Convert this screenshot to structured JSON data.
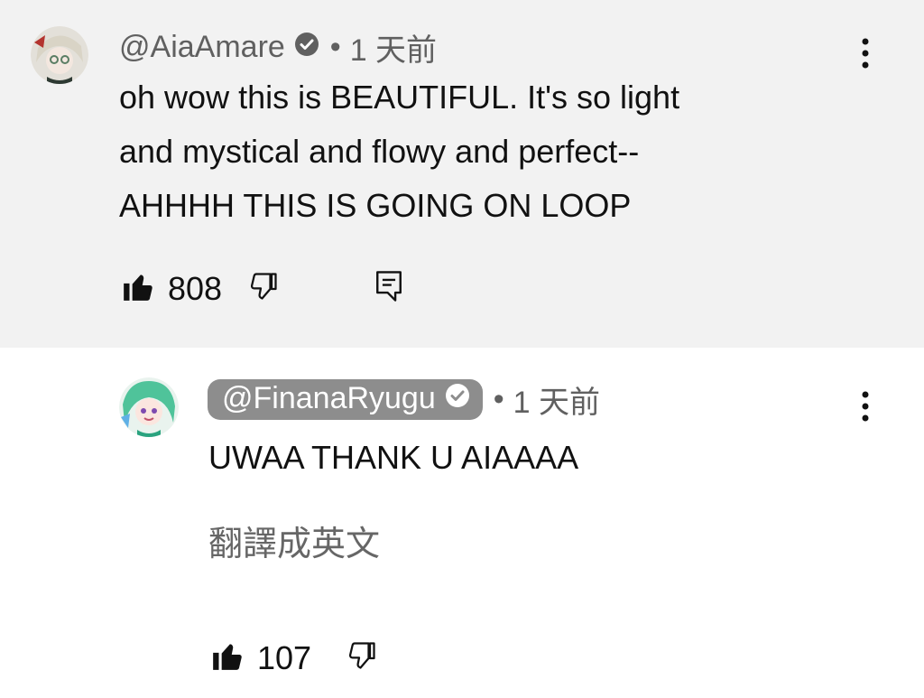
{
  "comments": [
    {
      "handle": "@AiaAmare",
      "time": "1 天前",
      "text_lines": [
        "oh wow this is BEAUTIFUL. It's so light",
        "and mystical and flowy and perfect--",
        "AHHHH THIS IS GOING ON LOOP"
      ],
      "likes": "808"
    },
    {
      "handle": "@FinanaRyugu",
      "time": "1 天前",
      "text": "UWAA THANK U AIAAAA",
      "translate_label": "翻譯成英文",
      "likes": "107"
    }
  ],
  "colors": {
    "highlight_bg": "#f2f2f2",
    "creator_pill": "#8d8d8d",
    "meta_text": "#606060"
  },
  "icons": {
    "verified": "check-circle-icon",
    "like": "thumb-up-icon",
    "dislike": "thumb-down-icon",
    "reply": "reply-comment-icon",
    "more": "more-vertical-icon"
  }
}
